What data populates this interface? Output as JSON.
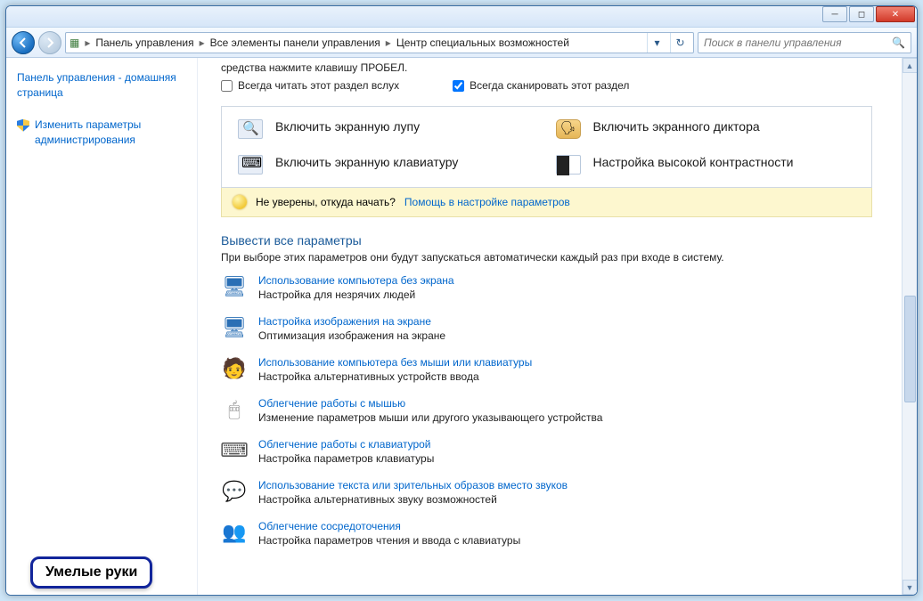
{
  "breadcrumb": {
    "c1": "Панель управления",
    "c2": "Все элементы панели управления",
    "c3": "Центр специальных возможностей"
  },
  "search": {
    "placeholder": "Поиск в панели управления"
  },
  "sidebar": {
    "home": "Панель управления - домашняя страница",
    "admin": "Изменить параметры администрирования"
  },
  "top": {
    "truncated": "средства нажмите клавишу ПРОБЕЛ.",
    "chk_read": "Всегда читать этот раздел вслух",
    "chk_scan": "Всегда сканировать этот раздел"
  },
  "quick": {
    "magnifier": "Включить экранную лупу",
    "narrator": "Включить экранного диктора",
    "keyboard": "Включить экранную клавиатуру",
    "contrast": "Настройка высокой контрастности"
  },
  "hint": {
    "q": "Не уверены, откуда начать?",
    "link": "Помощь в настройке параметров"
  },
  "section": {
    "title": "Вывести все параметры",
    "sub": "При выборе этих параметров они будут запускаться автоматически каждый раз при входе в систему."
  },
  "options": [
    {
      "title": "Использование компьютера без экрана",
      "desc": "Настройка для незрячих людей",
      "icon": "🖥",
      "cls": "ic-monitor"
    },
    {
      "title": "Настройка изображения на экране",
      "desc": "Оптимизация изображения на экране",
      "icon": "🖥",
      "cls": "ic-monitor"
    },
    {
      "title": "Использование компьютера без мыши или клавиатуры",
      "desc": "Настройка альтернативных устройств ввода",
      "icon": "🧑",
      "cls": "ic-person"
    },
    {
      "title": "Облегчение работы с мышью",
      "desc": "Изменение параметров мыши или другого указывающего устройства",
      "icon": "🖱",
      "cls": "ic-mouse"
    },
    {
      "title": "Облегчение работы с клавиатурой",
      "desc": "Настройка параметров клавиатуры",
      "icon": "⌨",
      "cls": "ic-kbd"
    },
    {
      "title": "Использование текста или зрительных образов вместо звуков",
      "desc": "Настройка альтернативных звуку возможностей",
      "icon": "💬",
      "cls": "ic-bubble"
    },
    {
      "title": "Облегчение сосредоточения",
      "desc": "Настройка параметров чтения и ввода с клавиатуры",
      "icon": "👥",
      "cls": "ic-people"
    }
  ],
  "watermark": "Умелые руки"
}
